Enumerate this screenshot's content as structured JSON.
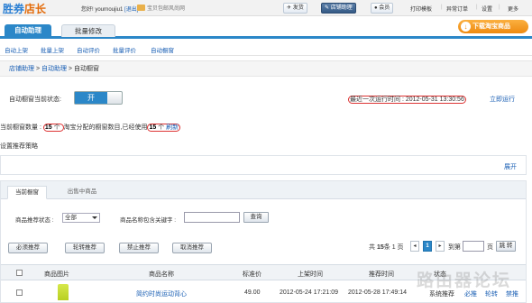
{
  "topbar": {
    "logo_part1": "胜券",
    "logo_part2": "店长",
    "greeting": "您好! yournoujiu1",
    "logout": "[退出]",
    "announcement": "宝贝包邮风尚网",
    "buttons": [
      "发货",
      "店铺助理"
    ],
    "member": "会员",
    "links": [
      "打印模板",
      "异常订单",
      "设置",
      "更多"
    ]
  },
  "main_tabs": {
    "active": "自动助理",
    "inactive": "批量修改"
  },
  "download_button": "下载淘宝商品",
  "subnav": [
    "自动上架",
    "批量上架",
    "自动评价",
    "批量评价",
    "自动橱窗"
  ],
  "breadcrumb": [
    "店铺助理",
    "自动助理",
    "自动橱窗"
  ],
  "status": {
    "label": "自动橱窗当前状态:",
    "toggle": "开",
    "last_run_label": "最近一次运行时间 : ",
    "last_run_time": "2012-05-31 13:30:56",
    "run_now": "立即运行"
  },
  "window_count": {
    "prefix": "当前橱窗数量 : ",
    "count": "15",
    "unit1": " 个 ",
    "middle": "淘宝分配的橱窗数目,已经使用",
    "used": "15",
    "unit2": " 个 ",
    "refresh": "刷新"
  },
  "strategy_label": "设置推荐策略",
  "expand": "展开",
  "panel_tabs": {
    "active": "当前橱窗",
    "inactive": "出售中商品"
  },
  "filter": {
    "status_label": "商品推荐状态 :",
    "status_value": "全部",
    "keyword_label": "商品名称包含关键字 :",
    "keyword_value": "",
    "query_button": "查询"
  },
  "action_buttons": [
    "必须推荐",
    "轮转推荐",
    "禁止推荐",
    "取消推荐"
  ],
  "pager": {
    "total_prefix": "共",
    "total_count": "15",
    "total_suffix": "条",
    "pages": "1 页",
    "prev": "◂",
    "current": "1",
    "next": "▸",
    "goto_label": "到第",
    "page_unit": "页",
    "jump": "跳 转"
  },
  "table": {
    "headers": [
      "商品图片",
      "商品名称",
      "标准价",
      "上架时间",
      "推荐时间",
      "状态"
    ],
    "rows": [
      {
        "name": "简约时尚运动背心",
        "price": "49.00",
        "list_time": "2012-05-24 17:21:09",
        "rec_time": "2012-05-28 17:49:14",
        "status": "系统推荐",
        "actions": [
          "必推",
          "轮转",
          "禁推"
        ]
      }
    ]
  },
  "watermark": "路由器论坛"
}
